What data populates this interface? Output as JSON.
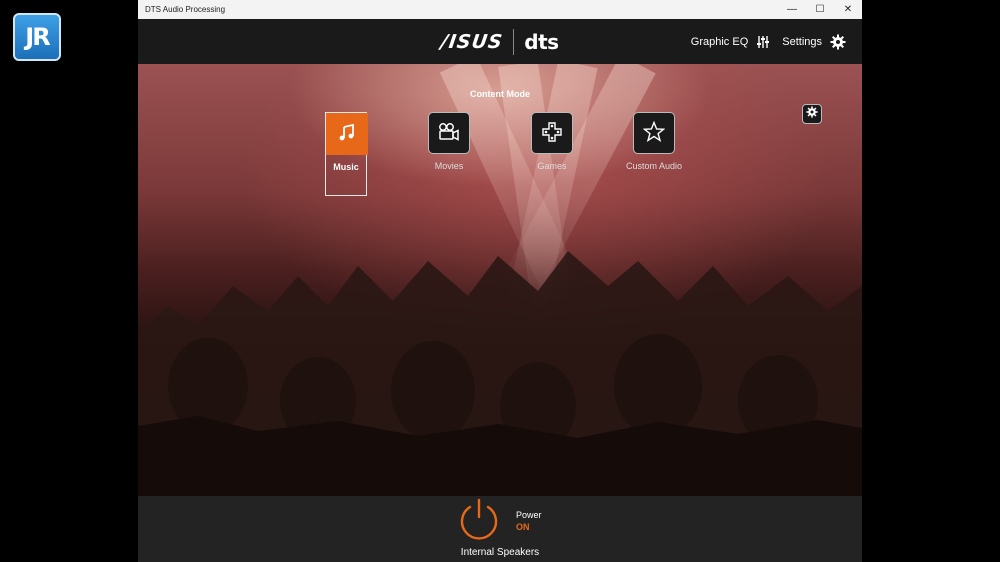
{
  "overlay_logo": {
    "text": "JR"
  },
  "window": {
    "title": "DTS Audio Processing",
    "controls": {
      "minimize": "—",
      "maximize": "☐",
      "close": "✕"
    }
  },
  "header": {
    "brand_asus": "/ISUS",
    "brand_dts": "dts",
    "graphic_eq_label": "Graphic EQ",
    "settings_label": "Settings"
  },
  "content_mode": {
    "title": "Content Mode",
    "modes": [
      {
        "label": "Music",
        "icon": "music-note-icon",
        "selected": true
      },
      {
        "label": "Movies",
        "icon": "movie-camera-icon",
        "selected": false
      },
      {
        "label": "Games",
        "icon": "gamepad-icon",
        "selected": false
      },
      {
        "label": "Custom Audio",
        "icon": "star-icon",
        "selected": false
      }
    ]
  },
  "footer": {
    "power_label": "Power",
    "power_state": "ON",
    "device": "Internal Speakers"
  },
  "colors": {
    "accent": "#e8681a",
    "header_bg": "#1a1a1a",
    "footer_bg": "#232323",
    "titlebar_bg": "#f3f3f3"
  }
}
